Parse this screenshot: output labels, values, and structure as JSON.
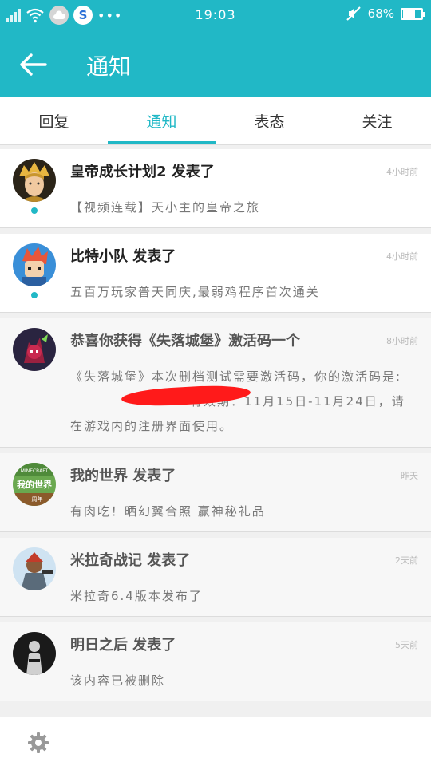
{
  "status_bar": {
    "time": "19:03",
    "battery": "68%",
    "battery_level": 0.68,
    "baidu_letter": "S",
    "dots": "•••"
  },
  "header": {
    "title": "通知"
  },
  "tabs": [
    {
      "label": "回复",
      "active": false
    },
    {
      "label": "通知",
      "active": true
    },
    {
      "label": "表态",
      "active": false
    },
    {
      "label": "关注",
      "active": false
    }
  ],
  "notifications": [
    {
      "title": "皇帝成长计划2 发表了",
      "time": "4小时前",
      "body": "【视频连载】天小主的皇帝之旅",
      "unread": true,
      "avatar": "emperor-avatar"
    },
    {
      "title": "比特小队 发表了",
      "time": "4小时前",
      "body": "五百万玩家普天同庆,最弱鸡程序首次通关",
      "unread": true,
      "avatar": "bit-squad-avatar"
    },
    {
      "title": "恭喜你获得《失落城堡》激活码一个",
      "time": "8小时前",
      "body": "《失落城堡》本次删档测试需要激活码，你的激活码是:",
      "body_2": "有效期：11月15日-11月24日，请在游戏内的注册界面使用。",
      "unread": false,
      "avatar": "lost-castle-avatar"
    },
    {
      "title": "我的世界 发表了",
      "time": "昨天",
      "body": "有肉吃！晒幻翼合照 赢神秘礼品",
      "unread": false,
      "avatar": "minecraft-avatar"
    },
    {
      "title": "米拉奇战记 发表了",
      "time": "2天前",
      "body": "米拉奇6.4版本发布了",
      "unread": false,
      "avatar": "miracle-war-avatar"
    },
    {
      "title": "明日之后 发表了",
      "time": "5天前",
      "body": "该内容已被删除",
      "unread": false,
      "avatar": "lifeafter-avatar"
    }
  ],
  "minecraft_badge": {
    "top": "MINECRAFT",
    "main": "我的世界",
    "sub": "一周年"
  },
  "footer": {
    "settings_icon": "gear-icon"
  }
}
